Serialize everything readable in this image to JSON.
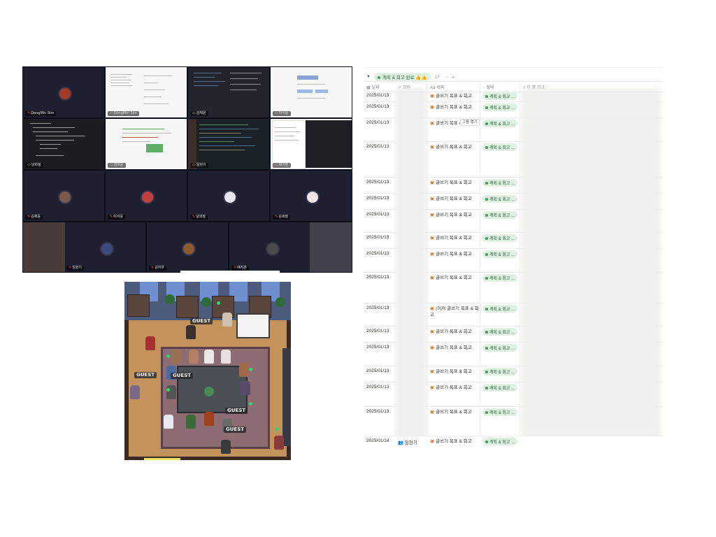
{
  "video": {
    "tiles": [
      {
        "name": "DongMin Sim",
        "kind": "camera",
        "muted": true
      },
      {
        "name": "DongMin Sim",
        "kind": "screen-light",
        "muted": false
      },
      {
        "name": "김채윤",
        "kind": "screen-dark",
        "muted": false
      },
      {
        "name": "이서윤",
        "kind": "screen-light",
        "muted": false
      },
      {
        "name": "남희정",
        "kind": "screen-dark",
        "muted": false
      },
      {
        "name": "김하윤",
        "kind": "screen-light",
        "muted": false
      },
      {
        "name": "임현기",
        "kind": "screen-dark",
        "muted": false
      },
      {
        "name": "배지훈",
        "kind": "screen-light",
        "muted": false
      },
      {
        "name": "김채윤",
        "kind": "camera",
        "muted": true
      },
      {
        "name": "이서윤",
        "kind": "camera",
        "muted": true
      },
      {
        "name": "남희정",
        "kind": "camera",
        "muted": true
      },
      {
        "name": "김세정",
        "kind": "camera",
        "muted": true
      },
      {
        "name": "임현기",
        "kind": "camera",
        "muted": true
      },
      {
        "name": "김하우",
        "kind": "camera",
        "muted": true
      },
      {
        "name": "배지훈",
        "kind": "camera",
        "muted": true
      }
    ]
  },
  "game": {
    "labels": [
      "GUEST",
      "GUEST",
      "GUEST",
      "GUEST",
      "GUEST"
    ]
  },
  "notion": {
    "group": {
      "label": "계획 & 회고 완료 👍👍",
      "count": "17",
      "more": "···",
      "add": "+"
    },
    "headers": {
      "date": "날짜",
      "author": "회원",
      "title": "제목",
      "status": "상태",
      "review": "한 줄 회고"
    },
    "open_label": "그룹 열기",
    "rows": [
      {
        "date": "2025/01/13",
        "title": "글쓰기 목표 & 회고",
        "status": "계획 & 회고 ..."
      },
      {
        "date": "2025/01/13",
        "title": "글쓰기 목표 & 회고",
        "status": "계획 & 회고 ..."
      },
      {
        "date": "2025/01/13",
        "title": "글쓰기 목표 &",
        "status": "계획 & 회고 ..."
      },
      {
        "date": "2025/01/13",
        "title": "글쓰기 목표 & 회고",
        "status": "계획 & 회고 ..."
      },
      {
        "date": "2025/01/13",
        "title": "글쓰기 목표 & 회고",
        "status": "계획 & 회고 ..."
      },
      {
        "date": "2025/01/13",
        "title": "글쓰기 목표 & 회고",
        "status": "계획 & 회고 ..."
      },
      {
        "date": "2025/01/13",
        "title": "글쓰기 목표 & 회고",
        "status": "계획 & 회고 ..."
      },
      {
        "date": "2025/01/13",
        "title": "글쓰기 목표 & 회고",
        "status": "계획 & 회고 ..."
      },
      {
        "date": "2025/01/13",
        "title": "글쓰기 목표 & 회고",
        "status": "계획 & 회고 ..."
      },
      {
        "date": "2025/01/13",
        "title": "글쓰기 목표 & 회고",
        "status": "계획 & 회고 ..."
      },
      {
        "date": "2025/01/13",
        "title": "(이저 글쓰기 목표 & 회고",
        "status": "계획 & 회고 ..."
      },
      {
        "date": "2025/01/13",
        "title": "글쓰기 목표 & 회고",
        "status": "계획 & 회고 ..."
      },
      {
        "date": "2025/01/13",
        "title": "글쓰기 목표 & 회고",
        "status": "계획 & 회고 ..."
      },
      {
        "date": "2025/01/13",
        "title": "글쓰기 목표 & 회고",
        "status": "계획 & 회고 ..."
      },
      {
        "date": "2025/01/13",
        "title": "글쓰기 목표 & 회고",
        "status": "계획 & 회고 ..."
      },
      {
        "date": "2025/01/13",
        "title": "글쓰기 목표 & 회고",
        "status": "계획 & 회고 ..."
      },
      {
        "date": "2025/01/14",
        "author": "임현기",
        "title": "글쓰기 목표 & 회고",
        "status": "계획 & 회고 ..."
      }
    ]
  },
  "colors": {
    "status_bg": "#dff1e3",
    "status_dot": "#3f9e5d",
    "conference_bg": "#121424"
  }
}
